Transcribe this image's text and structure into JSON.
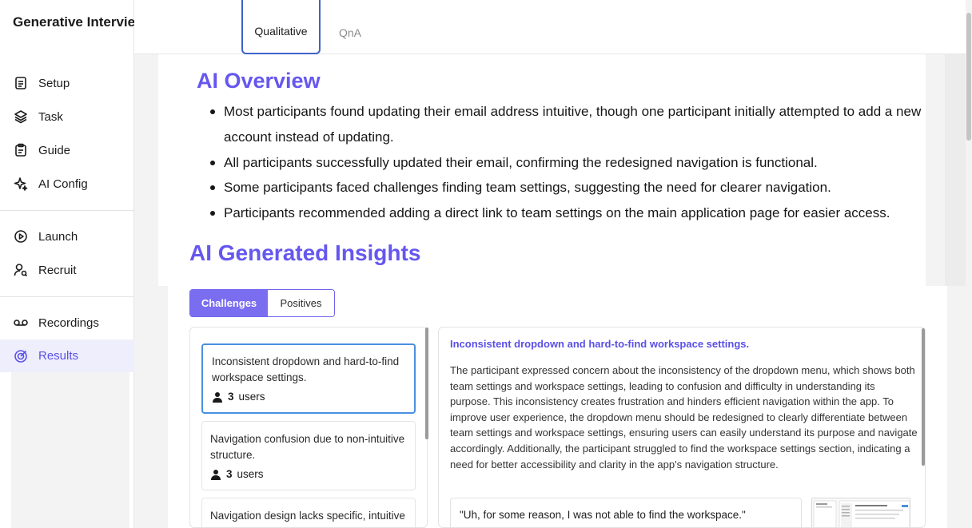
{
  "app": {
    "title": "Generative Interview"
  },
  "sidebar": {
    "items": [
      {
        "label": "Setup",
        "icon": "document-icon"
      },
      {
        "label": "Task",
        "icon": "layers-icon"
      },
      {
        "label": "Guide",
        "icon": "clipboard-icon"
      },
      {
        "label": "AI Config",
        "icon": "sparkles-icon"
      },
      {
        "label": "Launch",
        "icon": "play-circle-icon"
      },
      {
        "label": "Recruit",
        "icon": "user-search-icon"
      },
      {
        "label": "Recordings",
        "icon": "voicemail-icon"
      },
      {
        "label": "Results",
        "icon": "target-icon",
        "active": true
      }
    ]
  },
  "tabs": [
    {
      "label": "Qualitative",
      "active": true
    },
    {
      "label": "QnA",
      "active": false
    }
  ],
  "overview": {
    "title": "AI Overview",
    "bullets": [
      "Most participants found updating their email address intuitive, though one participant initially attempted to add a new account instead of updating.",
      "All participants successfully updated their email, confirming the redesigned navigation is functional.",
      "Some participants faced challenges finding team settings, suggesting the need for clearer navigation.",
      "Participants recommended adding a direct link to team settings on the main application page for easier access."
    ]
  },
  "insights": {
    "title": "AI Generated Insights",
    "toggle": {
      "challenges": "Challenges",
      "positives": "Positives",
      "selected": "Challenges"
    },
    "cards": [
      {
        "title": "Inconsistent dropdown and hard-to-find workspace settings.",
        "count": "3",
        "users_label": "users",
        "selected": true
      },
      {
        "title": "Navigation confusion due to non-intuitive structure.",
        "count": "3",
        "users_label": "users"
      },
      {
        "title": "Navigation design lacks specific, intuitive options.",
        "count": "",
        "users_label": ""
      }
    ],
    "detail": {
      "title": "Inconsistent dropdown and hard-to-find workspace settings.",
      "body": "The participant expressed concern about the inconsistency of the dropdown menu, which shows both team settings and workspace settings, leading to confusion and difficulty in understanding its purpose. This inconsistency creates frustration and hinders efficient navigation within the app. To improve user experience, the dropdown menu should be redesigned to clearly differentiate between team settings and workspace settings, ensuring users can easily understand its purpose and navigate accordingly. Additionally, the participant struggled to find the workspace settings section, indicating a need for better accessibility and clarity in the app's navigation structure.",
      "quote": "\"Uh, for some reason, I was not able to find the workspace.\""
    }
  },
  "colors": {
    "accent": "#6557ee",
    "active_bg": "#eeeefc",
    "tab_border": "#3e63c9",
    "card_selected": "#4a8fe0"
  }
}
